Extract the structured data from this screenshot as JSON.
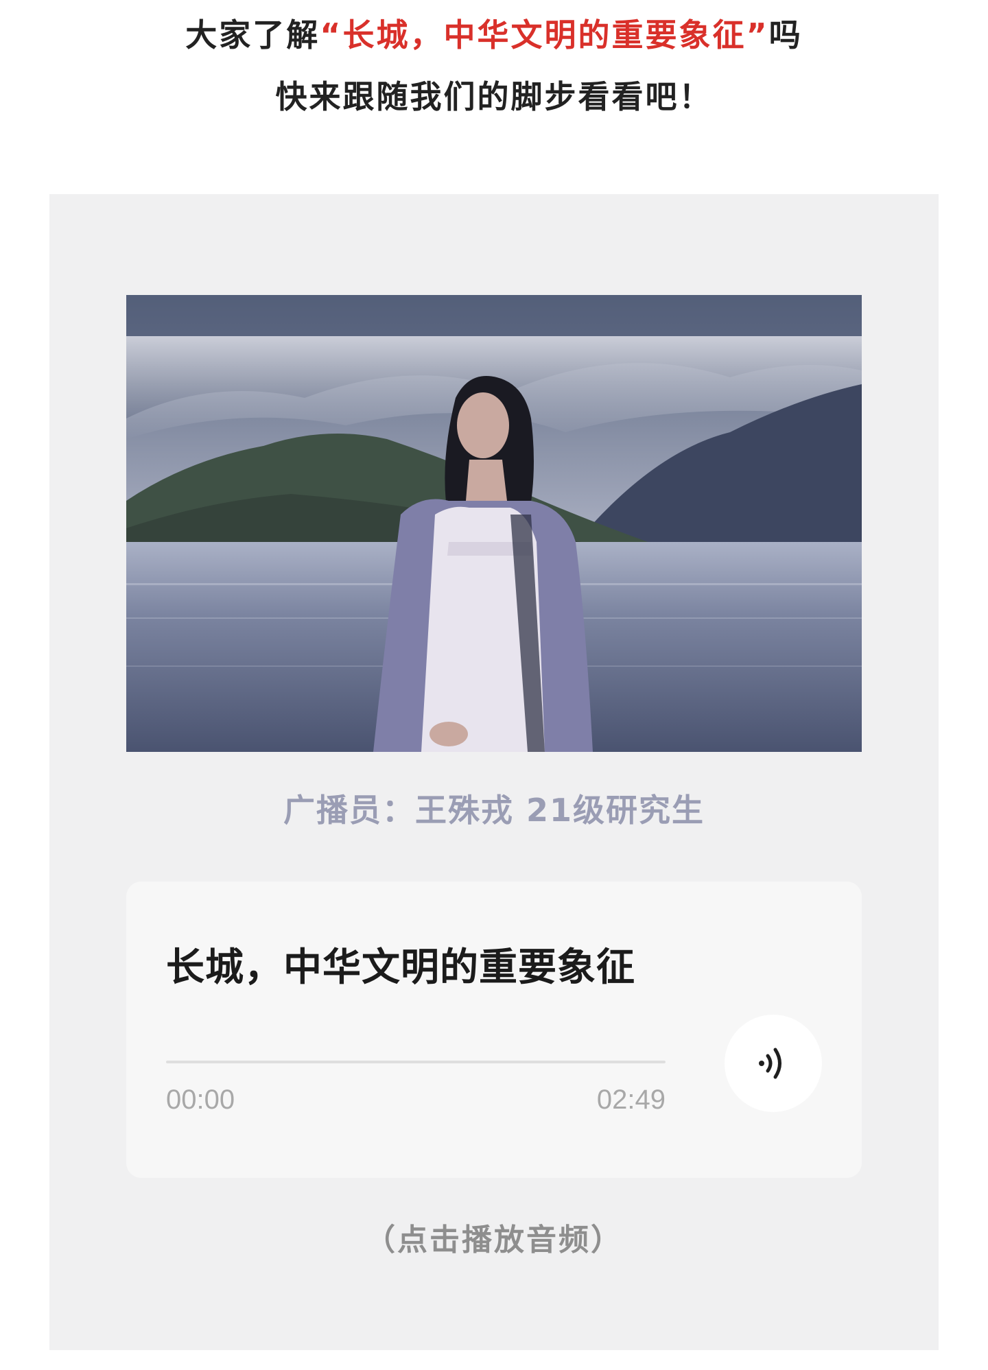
{
  "intro": {
    "line1_prefix": "大家了解",
    "line1_highlight": "“长城，中华文明的重要象征”",
    "line1_suffix": "吗",
    "line2": "快来跟随我们的脚步看看吧！"
  },
  "card": {
    "caption": "广播员：王殊戎 21级研究生",
    "player": {
      "title": "长城，中华文明的重要象征",
      "current_time": "00:00",
      "duration": "02:49",
      "progress": 0,
      "play_icon": "audio-wave-icon"
    },
    "hint": "（点击播放音频）"
  },
  "colors": {
    "highlight": "#d9302a",
    "card_bg": "#f0f0f1",
    "caption": "#9a9db4"
  }
}
